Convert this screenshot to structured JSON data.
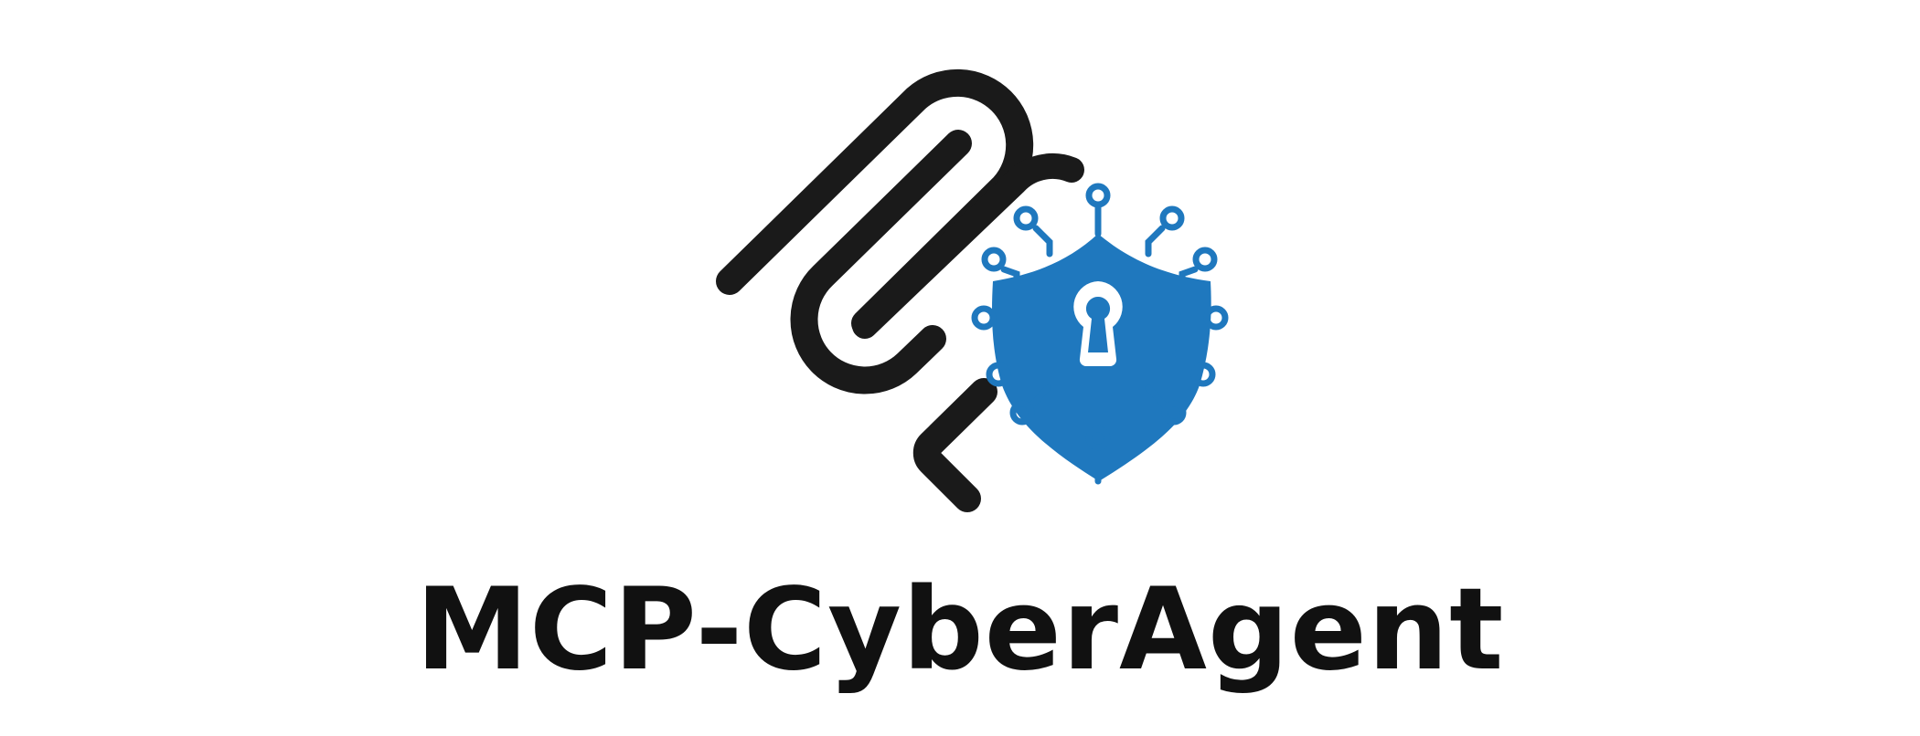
{
  "logo": {
    "wordmark": "MCP-CyberAgent",
    "mark_color": "#1a1a1a",
    "shield_color": "#1f78be",
    "icons": [
      "mcp-connector-icon",
      "shield-keyhole-icon",
      "circuit-node-icon"
    ]
  }
}
